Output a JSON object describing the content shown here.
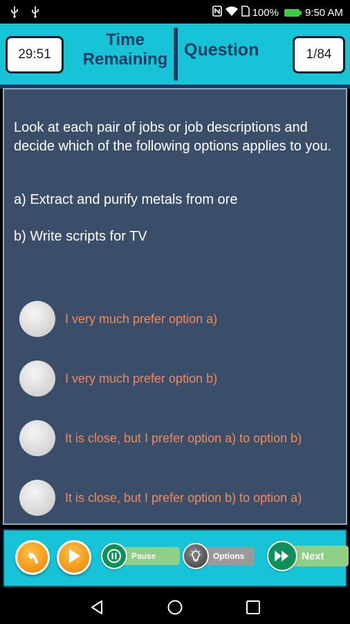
{
  "status_bar": {
    "battery": "100%",
    "time": "9:50 AM",
    "icons": [
      "usb-icon",
      "usb-icon",
      "nfc-icon",
      "wifi-icon",
      "sim-icon",
      "battery-icon"
    ]
  },
  "header": {
    "timer_value": "29:51",
    "time_label_line1": "Time",
    "time_label_line2": "Remaining",
    "question_label": "Question",
    "question_count": "1/84"
  },
  "question": {
    "prompt": "Look at each pair of jobs or job descriptions and decide which of the following options applies to you.",
    "option_a": "a) Extract and purify metals from ore",
    "option_b": "b) Write scripts for TV"
  },
  "answers": [
    {
      "label": "I very much prefer option a)"
    },
    {
      "label": "I very much prefer option b)"
    },
    {
      "label": "It is close, but I prefer option a) to option b)"
    },
    {
      "label": "It is close, but I prefer option b) to option a)"
    }
  ],
  "toolbar": {
    "pause_label": "Pause",
    "options_label": "Options",
    "next_label": "Next"
  },
  "colors": {
    "accent": "#17c3d6",
    "card": "#3b4e69",
    "answer_text": "#f08a5a",
    "header_text": "#0e3e66"
  }
}
